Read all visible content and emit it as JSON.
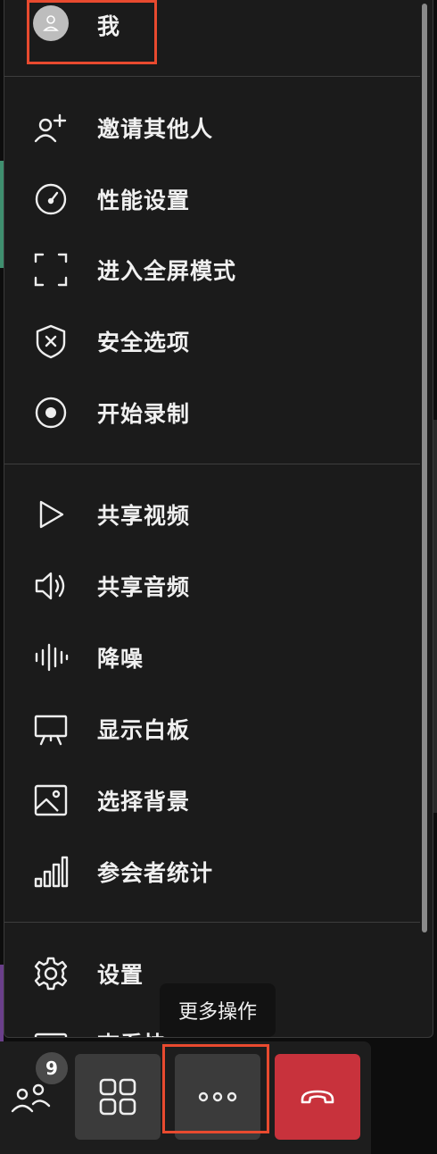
{
  "menu": {
    "me": {
      "label": "我"
    },
    "items": [
      {
        "label": "邀请其他人",
        "icon": "add-person-icon"
      },
      {
        "label": "性能设置",
        "icon": "gauge-icon"
      },
      {
        "label": "进入全屏模式",
        "icon": "fullscreen-icon"
      },
      {
        "label": "安全选项",
        "icon": "shield-x-icon"
      },
      {
        "label": "开始录制",
        "icon": "record-icon"
      },
      {
        "label": "共享视频",
        "icon": "play-icon"
      },
      {
        "label": "共享音频",
        "icon": "speaker-icon"
      },
      {
        "label": "降噪",
        "icon": "waveform-icon"
      },
      {
        "label": "显示白板",
        "icon": "whiteboard-icon"
      },
      {
        "label": "选择背景",
        "icon": "image-icon"
      },
      {
        "label": "参会者统计",
        "icon": "bar-chart-icon"
      },
      {
        "label": "设置",
        "icon": "gear-icon"
      },
      {
        "label": "查看快捷键",
        "icon": "keyboard-icon"
      }
    ]
  },
  "tooltip": {
    "text": "更多操作"
  },
  "toolbar": {
    "participants_count": "9",
    "buttons": [
      "participants-icon",
      "grid-view-icon",
      "more-dots-icon",
      "hang-up-icon"
    ]
  },
  "colors": {
    "highlight": "#e84a2f",
    "hangup": "#c8323c",
    "menu_bg": "#1b1b1b"
  }
}
